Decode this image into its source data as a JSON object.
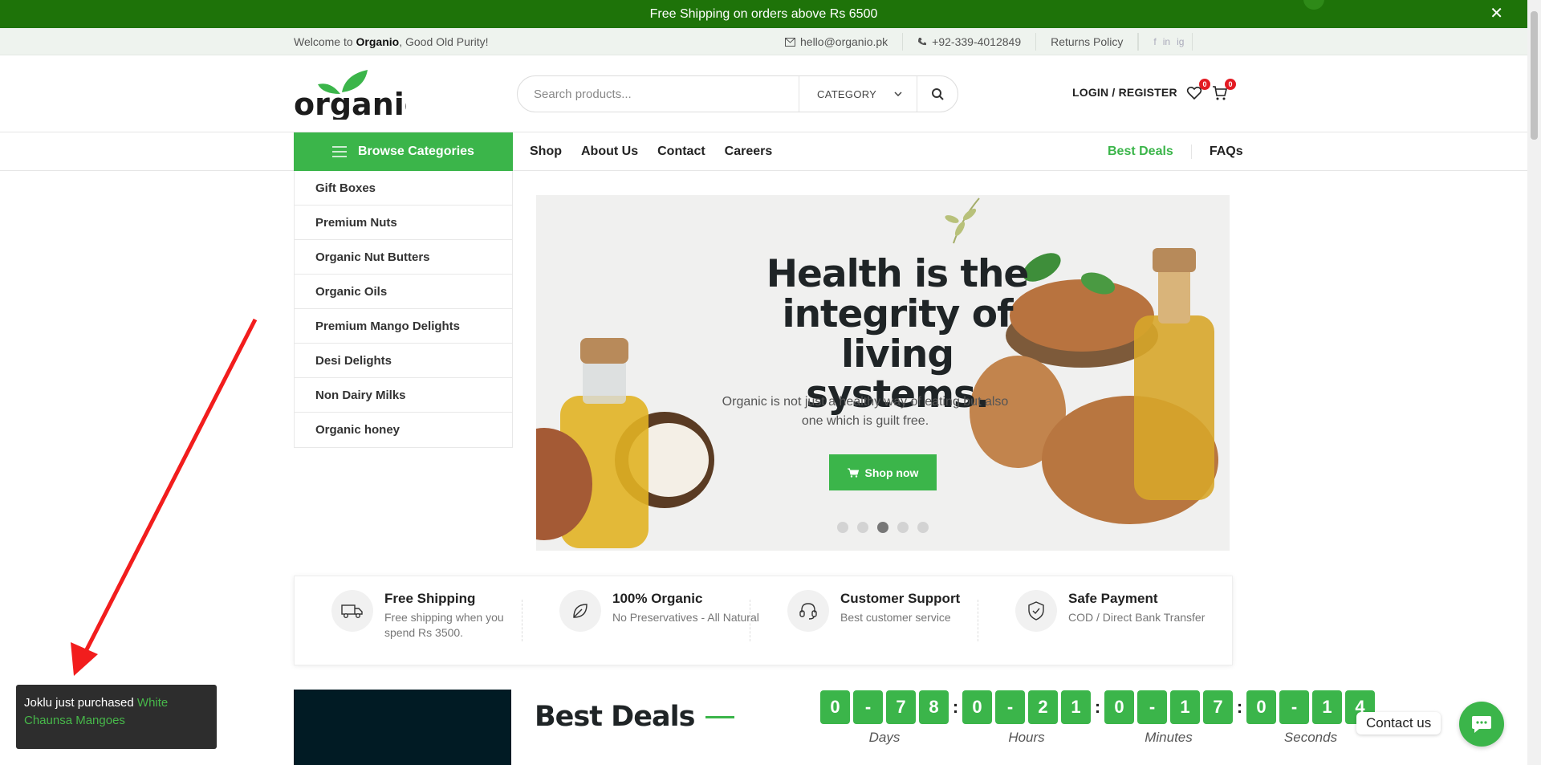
{
  "topbar": {
    "message": "Free Shipping on orders above Rs 6500",
    "close_glyph": "✕"
  },
  "infobar": {
    "welcome_prefix": "Welcome to ",
    "brand": "Organio",
    "welcome_suffix": ", Good Old Purity!",
    "email": "hello@organio.pk",
    "phone": "+92-339-4012849",
    "returns": "Returns Policy",
    "social": [
      "f",
      "in",
      "ig"
    ]
  },
  "header": {
    "logo_text": "organio",
    "search_placeholder": "Search products...",
    "category_label": "CATEGORY",
    "login_label": "LOGIN / REGISTER",
    "wishlist_count": "0",
    "cart_count": "0"
  },
  "nav": {
    "browse_label": "Browse Categories",
    "menu": [
      "Shop",
      "About Us",
      "Contact",
      "Careers"
    ],
    "best_deals": "Best Deals",
    "faqs": "FAQs"
  },
  "categories": [
    "Gift Boxes",
    "Premium Nuts",
    "Organic Nut Butters",
    "Organic Oils",
    "Premium Mango Delights",
    "Desi Delights",
    "Non Dairy Milks",
    "Organic honey"
  ],
  "hero": {
    "heading": "Health is the integrity of living systems.",
    "subtext": "Organic is not just a healthy way of eating but also one which is guilt free.",
    "button": "Shop now",
    "slide_count": 5,
    "active_slide": 3
  },
  "features": [
    {
      "title": "Free Shipping",
      "desc": "Free shipping when you spend Rs 3500.",
      "icon": "truck-icon"
    },
    {
      "title": "100% Organic",
      "desc": "No Preservatives - All Natural",
      "icon": "leaf-icon"
    },
    {
      "title": "Customer Support",
      "desc": "Best customer service",
      "icon": "headset-icon"
    },
    {
      "title": "Safe Payment",
      "desc": "COD / Direct Bank Transfer",
      "icon": "shield-icon"
    }
  ],
  "deals": {
    "title": "Best Deals",
    "countdown": [
      {
        "digits": [
          "0",
          "-",
          "7",
          "8"
        ],
        "label": "Days"
      },
      {
        "digits": [
          "0",
          "-",
          "2",
          "1"
        ],
        "label": "Hours"
      },
      {
        "digits": [
          "0",
          "-",
          "1",
          "7"
        ],
        "label": "Minutes"
      },
      {
        "digits": [
          "0",
          "-",
          "1",
          "4"
        ],
        "label": "Seconds"
      }
    ],
    "separator": ":"
  },
  "toast": {
    "prefix": "Joklu just purchased ",
    "product": "White Chaunsa Mangoes"
  },
  "contact": {
    "label": "Contact us"
  },
  "colors": {
    "brand_green": "#3bb54a",
    "topbar_green": "#1e7309",
    "badge_red": "#e31b23"
  }
}
